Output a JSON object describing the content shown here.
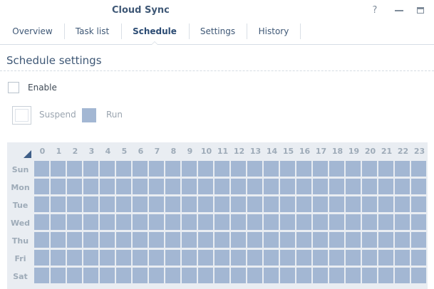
{
  "window": {
    "title": "Cloud Sync",
    "help_glyph": "?"
  },
  "tabs": [
    {
      "label": "Overview",
      "active": false
    },
    {
      "label": "Task list",
      "active": false
    },
    {
      "label": "Schedule",
      "active": true
    },
    {
      "label": "Settings",
      "active": false
    },
    {
      "label": "History",
      "active": false
    }
  ],
  "schedule": {
    "section_title": "Schedule settings",
    "enable_label": "Enable",
    "enable_checked": false,
    "legend": {
      "suspend_label": "Suspend",
      "run_label": "Run"
    },
    "hours": [
      "0",
      "1",
      "2",
      "3",
      "4",
      "5",
      "6",
      "7",
      "8",
      "9",
      "10",
      "11",
      "12",
      "13",
      "14",
      "15",
      "16",
      "17",
      "18",
      "19",
      "20",
      "21",
      "22",
      "23"
    ],
    "days": [
      "Sun",
      "Mon",
      "Tue",
      "Wed",
      "Thu",
      "Fri",
      "Sat"
    ],
    "cell_state": "run"
  },
  "colors": {
    "run": "#a3b7d3",
    "accent": "#3f5876",
    "corner": "#3f5f88"
  }
}
